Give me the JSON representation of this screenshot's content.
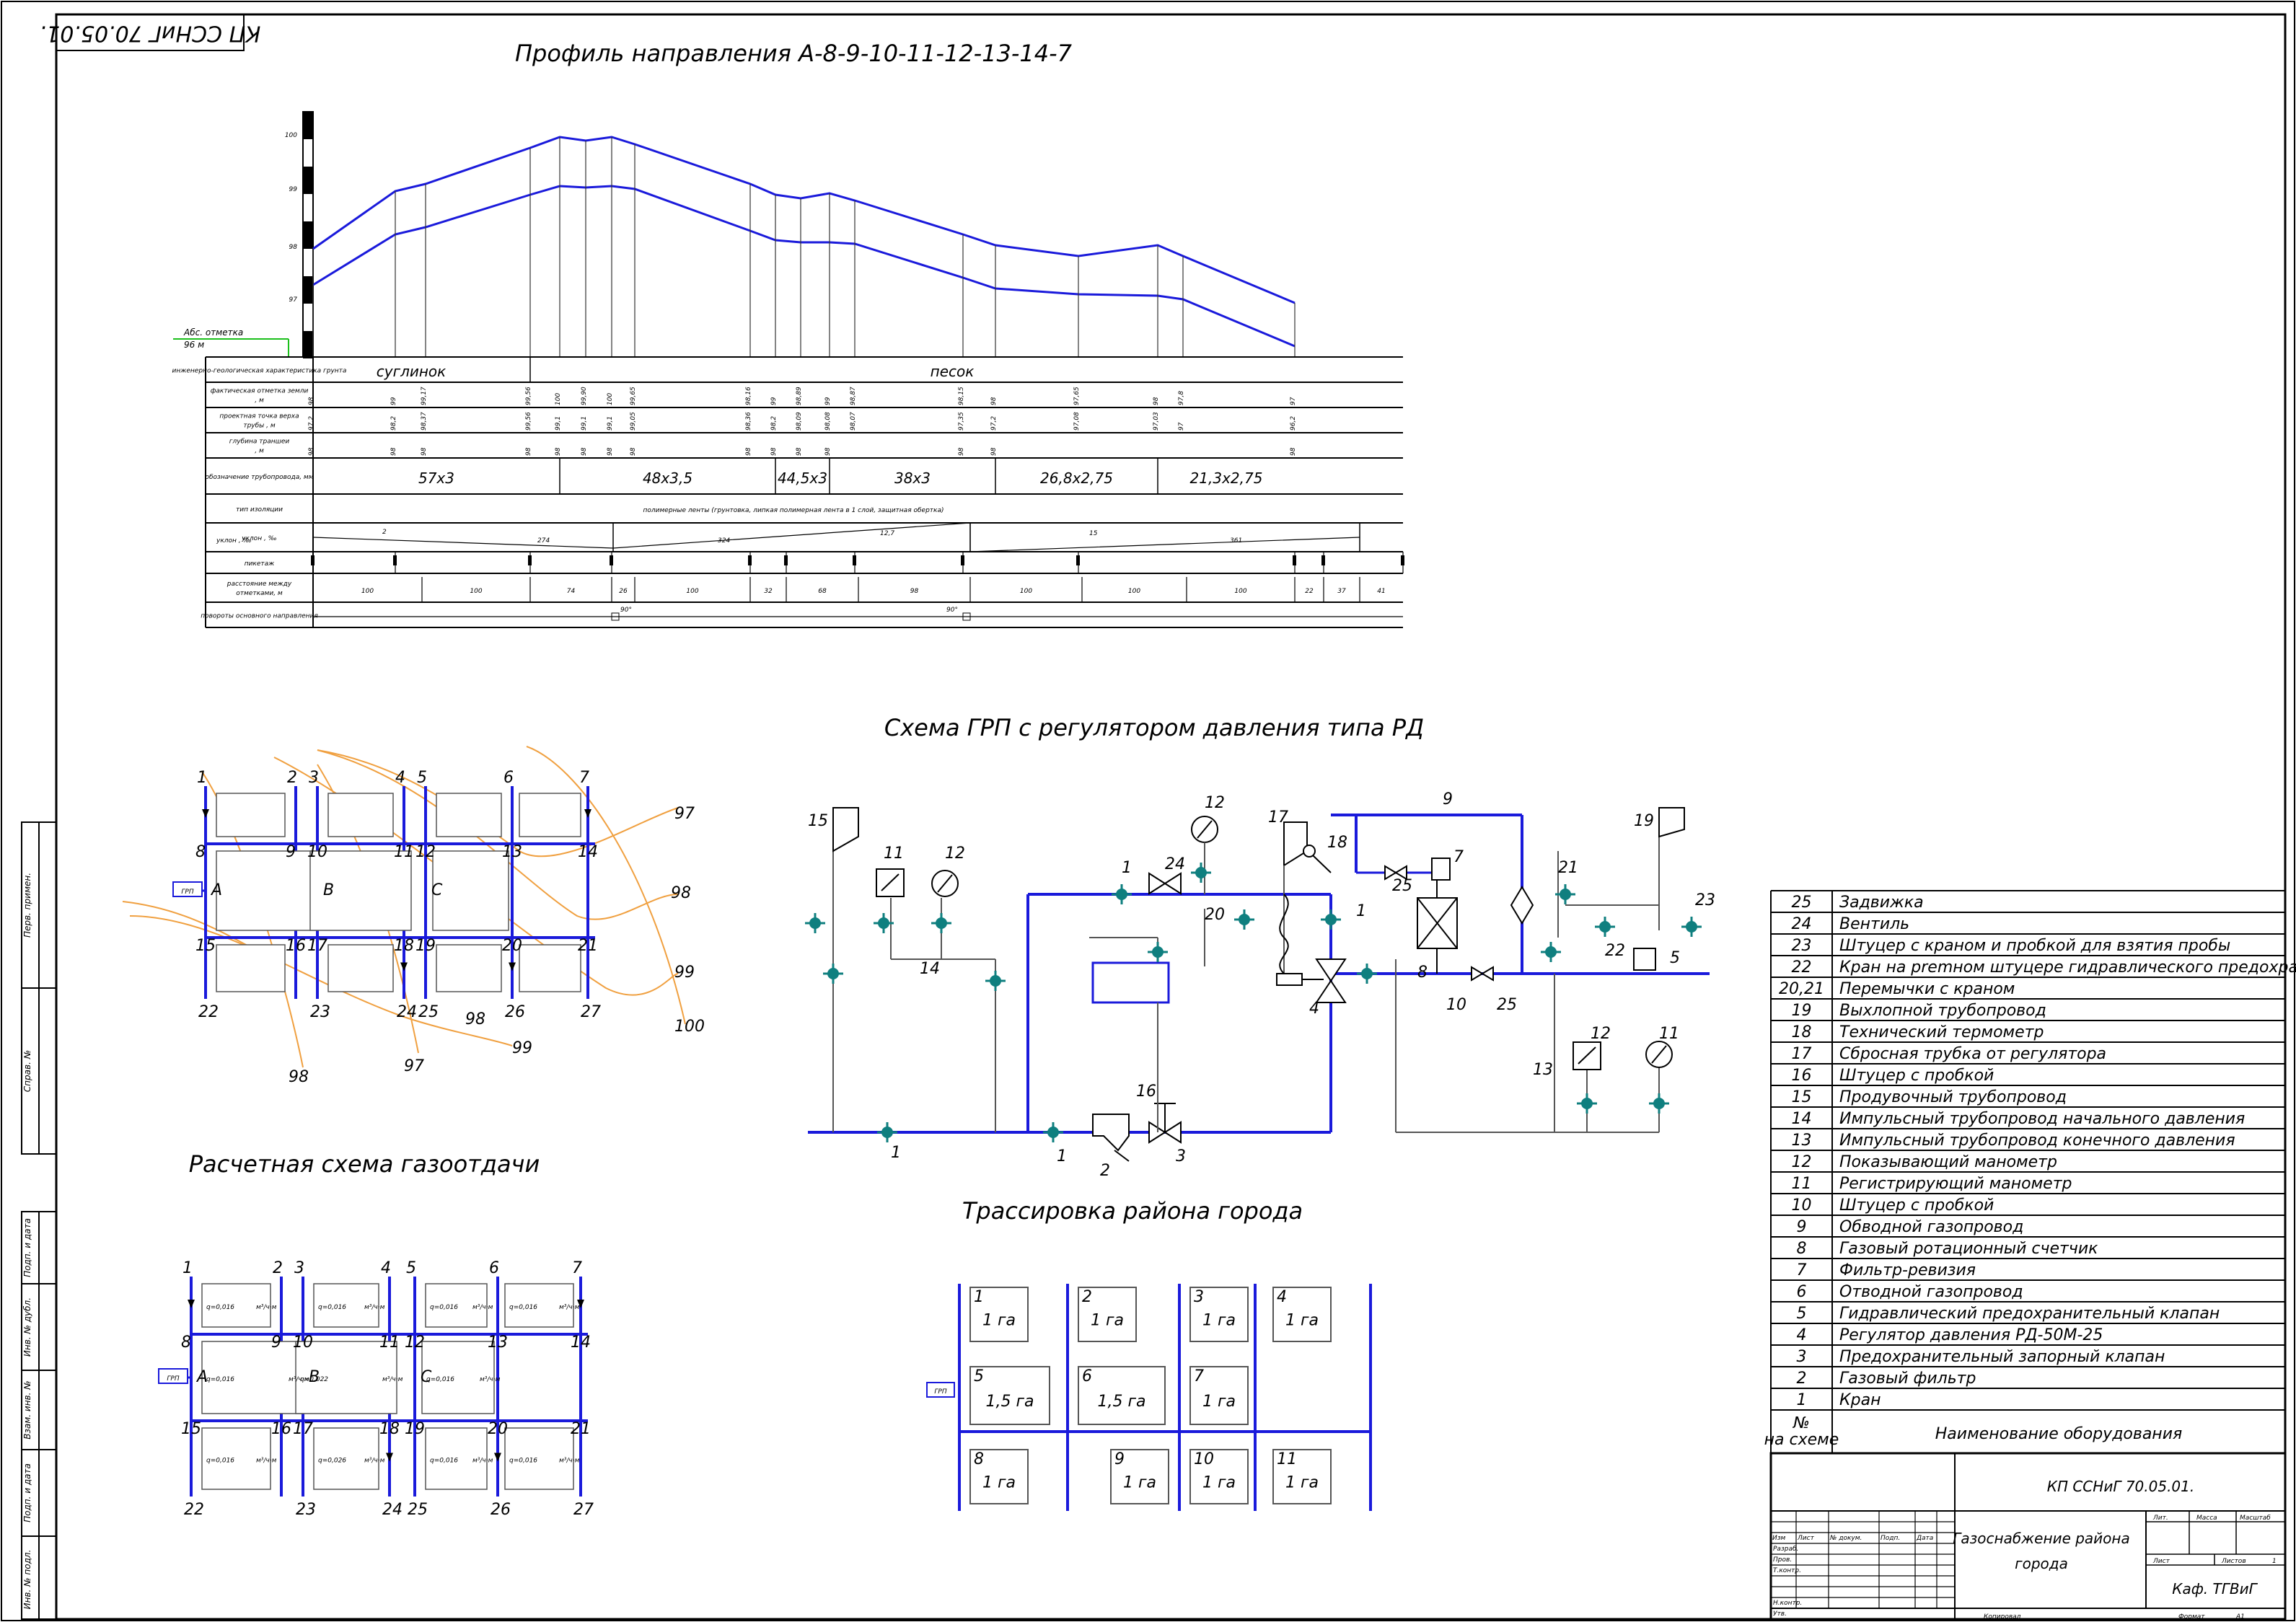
{
  "stamp": "КП ССНиГ 70.05.01.",
  "profile": {
    "title": "Профиль направления А-8-9-10-11-12-13-14-7",
    "abs_label": "Абс. отметка",
    "abs_value": "96 м",
    "scale": [
      "100",
      "99",
      "98",
      "97"
    ],
    "rows": [
      "инженерно-геологическая характеристика грунта",
      "фактическая отметка земли , м",
      "проектная точка верха трубы , м",
      "глубина траншеи , м",
      "обозначение трубопровода, мм",
      "тип изоляции",
      "уклон , ‰",
      "пикетаж",
      "расстояние между отметками, м",
      "повороты основного направления"
    ],
    "soil": [
      "суглинок",
      "песок"
    ],
    "ground": [
      "98",
      "99",
      "99,17",
      "99,56",
      "100",
      "99,90",
      "100",
      "99,65",
      "98,16",
      "99",
      "98,89",
      "99",
      "98,87",
      "98,15",
      "98",
      "97,65",
      "98",
      "97,8",
      "97"
    ],
    "design": [
      "97,2",
      "98,2",
      "98,37",
      "99,56",
      "99,1",
      "99,1",
      "99,1",
      "99,05",
      "98,36",
      "98,2",
      "98,09",
      "98,08",
      "98,07",
      "97,35",
      "97,2",
      "97,08",
      "97,03",
      "97",
      "96,2"
    ],
    "depth": [
      "98",
      "98",
      "98",
      "98",
      "98",
      "98",
      "98",
      "98",
      "98",
      "98",
      "98",
      "98",
      "98",
      "98",
      "98"
    ],
    "pipes": [
      "57х3",
      "48х3,5",
      "44,5х3",
      "38х3",
      "26,8х2,75",
      "21,3х2,75"
    ],
    "insulation": "полимерные ленты (грунтовка, липкая полимерная лента в 1 слой, защитная обертка)",
    "slopes": [
      "2",
      "274",
      "324",
      "12,7",
      "15",
      "361"
    ],
    "distances": [
      "100",
      "100",
      "74",
      "26",
      "100",
      "32",
      "68",
      "98",
      "100",
      "100",
      "100",
      "22",
      "37",
      "41"
    ],
    "turns": [
      "90°",
      "90°"
    ]
  },
  "grp": {
    "title": "Схема ГРП с регулятором давления типа РД",
    "labels": [
      "15",
      "11",
      "12",
      "14",
      "1",
      "1",
      "1",
      "2",
      "3",
      "24",
      "12",
      "20",
      "17",
      "18",
      "1",
      "4",
      "16",
      "9",
      "25",
      "7",
      "8",
      "10",
      "25",
      "21",
      "19",
      "22",
      "23",
      "5",
      "13",
      "12",
      "11"
    ]
  },
  "calc": {
    "title": "Расчетная схема газоотдачи",
    "grp_label": "ГРП",
    "nodes_top": [
      "1",
      "2",
      "3",
      "4",
      "5",
      "6",
      "7"
    ],
    "nodes_mid": [
      "8",
      "9",
      "10",
      "11",
      "12",
      "13",
      "14"
    ],
    "nodes_low": [
      "15",
      "16",
      "17",
      "18",
      "19",
      "20",
      "21"
    ],
    "nodes_bot": [
      "22",
      "23",
      "24",
      "25",
      "26",
      "27"
    ],
    "blocks": [
      "A",
      "B",
      "C"
    ],
    "q_values": [
      "q=0,016",
      "q=0,016",
      "q=0,016",
      "q=0,016",
      "q=0,016",
      "q=0,022",
      "q=0,016",
      "q=0,016",
      "q=0,026",
      "q=0,016",
      "q=0,016"
    ],
    "unit": "м³/ч·м"
  },
  "scheme": {
    "grp_label": "ГРП",
    "nodes_top": [
      "1",
      "2",
      "3",
      "4",
      "5",
      "6",
      "7"
    ],
    "nodes_mid": [
      "8",
      "9",
      "10",
      "11",
      "12",
      "13",
      "14"
    ],
    "nodes_low": [
      "15",
      "16",
      "17",
      "18",
      "19",
      "20",
      "21"
    ],
    "nodes_bot": [
      "22",
      "23",
      "24",
      "25",
      "26",
      "27"
    ],
    "blocks": [
      "A",
      "B",
      "C"
    ],
    "isolines": [
      "97",
      "98",
      "99",
      "100",
      "99",
      "98",
      "97",
      "98"
    ]
  },
  "trace": {
    "title": "Трассировка района города",
    "grp_label": "ГРП",
    "blocks": [
      {
        "n": "1",
        "a": "1 га"
      },
      {
        "n": "2",
        "a": "1 га"
      },
      {
        "n": "3",
        "a": "1 га"
      },
      {
        "n": "4",
        "a": "1 га"
      },
      {
        "n": "5",
        "a": "1,5 га"
      },
      {
        "n": "6",
        "a": "1,5 га"
      },
      {
        "n": "7",
        "a": "1 га"
      },
      {
        "n": "8",
        "a": "1 га"
      },
      {
        "n": "9",
        "a": "1 га"
      },
      {
        "n": "10",
        "a": "1 га"
      },
      {
        "n": "11",
        "a": "1 га"
      }
    ]
  },
  "equipment": {
    "rows": [
      {
        "n": "25",
        "name": "Задвижка"
      },
      {
        "n": "24",
        "name": "Вентиль"
      },
      {
        "n": "23",
        "name": "Штуцер с краном и пробкой для взятия пробы"
      },
      {
        "n": "22",
        "name": "Кран на premном штуцере гидравлического предохранителя"
      },
      {
        "n": "20,21",
        "name": "Перемычки с краном"
      },
      {
        "n": "19",
        "name": "Выхлопной трубопровод"
      },
      {
        "n": "18",
        "name": "Технический термометр"
      },
      {
        "n": "17",
        "name": "Сбросная трубка от регулятора"
      },
      {
        "n": "16",
        "name": "Штуцер с пробкой"
      },
      {
        "n": "15",
        "name": "Продувочный трубопровод"
      },
      {
        "n": "14",
        "name": "Импульсный трубопровод начального давления"
      },
      {
        "n": "13",
        "name": "Импульсный трубопровод конечного давления"
      },
      {
        "n": "12",
        "name": "Показывающий манометр"
      },
      {
        "n": "11",
        "name": "Регистрирующий манометр"
      },
      {
        "n": "10",
        "name": "Штуцер с пробкой"
      },
      {
        "n": "9",
        "name": "Обводной газопровод"
      },
      {
        "n": "8",
        "name": "Газовый ротационный счетчик"
      },
      {
        "n": "7",
        "name": "Фильтр-ревизия"
      },
      {
        "n": "6",
        "name": "Отводной газопровод"
      },
      {
        "n": "5",
        "name": "Гидравлический предохранительный клапан"
      },
      {
        "n": "4",
        "name": "Регулятор давления РД-50М-25"
      },
      {
        "n": "3",
        "name": "Предохранительный запорный клапан"
      },
      {
        "n": "2",
        "name": "Газовый фильтр"
      },
      {
        "n": "1",
        "name": "Кран"
      }
    ],
    "col_num": "№ на схеме",
    "col_name": "Наименование оборудования"
  },
  "titleblock": {
    "doc": "КП ССНиГ 70.05.01.",
    "name": "Газоснабжение района города",
    "cols": [
      "Изм",
      "Лист",
      "№ докум.",
      "Подп.",
      "Дата"
    ],
    "rows": [
      "Разраб.",
      "Пров.",
      "Т.контр.",
      "",
      "Н.контр.",
      "Утв."
    ],
    "lit": "Лит.",
    "mass": "Масса",
    "scale": "Масштаб",
    "sheet": "Лист",
    "sheets": "Листов",
    "sheets_n": "1",
    "org": "Каф. ТГВиГ",
    "copied": "Копировал",
    "format": "Формат",
    "format_v": "А1"
  },
  "side": [
    "Перв. примен.",
    "Справ. №",
    "Подп. и дата",
    "Инв. № дубл.",
    "Взам. инв. №",
    "Подп. и дата",
    "Инв. № подл."
  ]
}
